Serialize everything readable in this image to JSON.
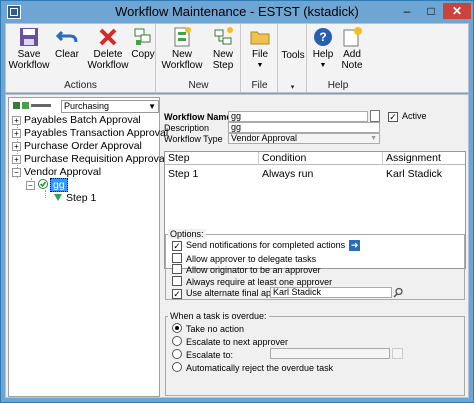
{
  "window": {
    "title": "Workflow Maintenance  -  ESTST (kstadick)",
    "controls": {
      "minimize": "–",
      "maximize": "□",
      "close": "✕"
    }
  },
  "ribbon": {
    "groups": [
      {
        "label": "Actions",
        "buttons": [
          {
            "label1": "Save",
            "label2": "Workflow",
            "icon": "floppy-disk-icon"
          },
          {
            "label1": "Clear",
            "label2": "",
            "icon": "undo-arrow-icon"
          },
          {
            "label1": "Delete",
            "label2": "Workflow",
            "icon": "red-x-icon"
          },
          {
            "label1": "Copy",
            "label2": "",
            "icon": "copy-icon"
          }
        ]
      },
      {
        "label": "New",
        "buttons": [
          {
            "label1": "New",
            "label2": "Workflow",
            "icon": "new-workflow-icon"
          },
          {
            "label1": "New",
            "label2": "Step",
            "icon": "new-step-icon"
          }
        ]
      },
      {
        "label": "File",
        "buttons": [
          {
            "label1": "File",
            "label2": "",
            "icon": "folder-icon"
          }
        ]
      },
      {
        "label": "",
        "buttons": [
          {
            "label1": "Tools",
            "label2": "",
            "icon": "tools-icon"
          }
        ]
      },
      {
        "label": "Help",
        "buttons": [
          {
            "label1": "Help",
            "label2": "",
            "icon": "help-icon"
          },
          {
            "label1": "Add",
            "label2": "Note",
            "icon": "add-note-icon"
          }
        ]
      }
    ]
  },
  "tree": {
    "selector_value": "Purchasing",
    "items": [
      "Payables Batch Approval",
      "Payables Transaction Approval",
      "Purchase Order Approval",
      "Purchase Requisition Approval",
      "Vendor Approval"
    ],
    "workflow_node": "gg",
    "step_node": "Step 1"
  },
  "form": {
    "workflow_name_label": "Workflow Name",
    "workflow_name_value": "gg",
    "description_label": "Description",
    "description_value": "gg",
    "workflow_type_label": "Workflow Type",
    "workflow_type_value": "Vendor Approval",
    "active_label": "Active",
    "active_checked": true
  },
  "grid": {
    "columns": [
      "Step",
      "Condition",
      "Assignment"
    ],
    "rows": [
      [
        "Step 1",
        "Always run",
        "Karl Stadick"
      ]
    ]
  },
  "options": {
    "title": "Options:",
    "items": [
      {
        "label": "Send notifications for completed actions",
        "checked": true
      },
      {
        "label": "Allow approver to delegate tasks",
        "checked": false
      },
      {
        "label": "Allow originator to be an approver",
        "checked": false
      },
      {
        "label": "Always require at least one approver",
        "checked": false
      },
      {
        "label": "Use alternate final approver",
        "checked": true
      }
    ],
    "alternate_approver_value": "Karl Stadick"
  },
  "overdue": {
    "title": "When a task is overdue:",
    "items": [
      {
        "label": "Take no action",
        "selected": true
      },
      {
        "label": "Escalate to next approver",
        "selected": false
      },
      {
        "label": "Escalate to:",
        "selected": false
      },
      {
        "label": "Automatically reject the overdue task",
        "selected": false
      }
    ]
  }
}
